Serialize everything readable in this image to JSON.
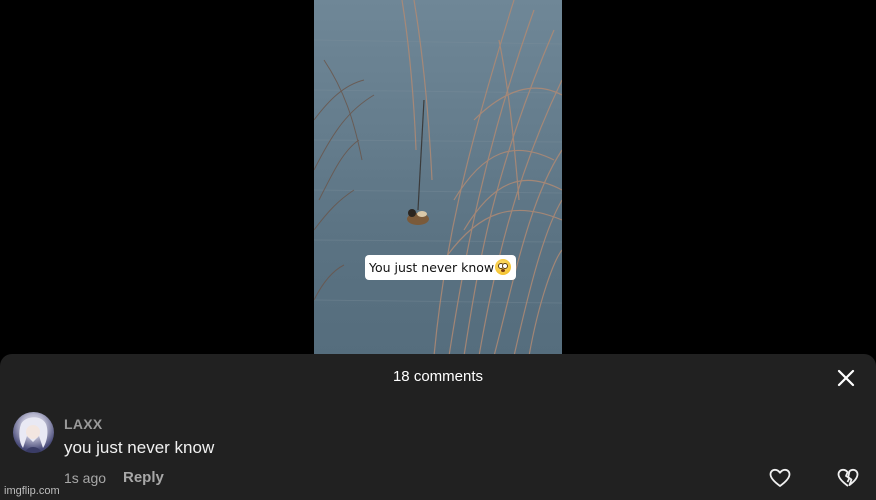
{
  "video": {
    "caption": "You just never know",
    "caption_emoji": "flushed-face-emoji"
  },
  "comments_sheet": {
    "title": "18 comments",
    "close_icon": "close-icon",
    "comment": {
      "username": "LAXX",
      "text": "you just never know",
      "time": "1s ago",
      "reply_label": "Reply",
      "like_icon": "heart-outline-icon",
      "dislike_icon": "broken-heart-icon"
    }
  },
  "watermark": "imgflip.com",
  "colors": {
    "background": "#000000",
    "sheet": "#212121",
    "primary_text": "#f1f1f1",
    "secondary_text": "#a8a8a8"
  }
}
